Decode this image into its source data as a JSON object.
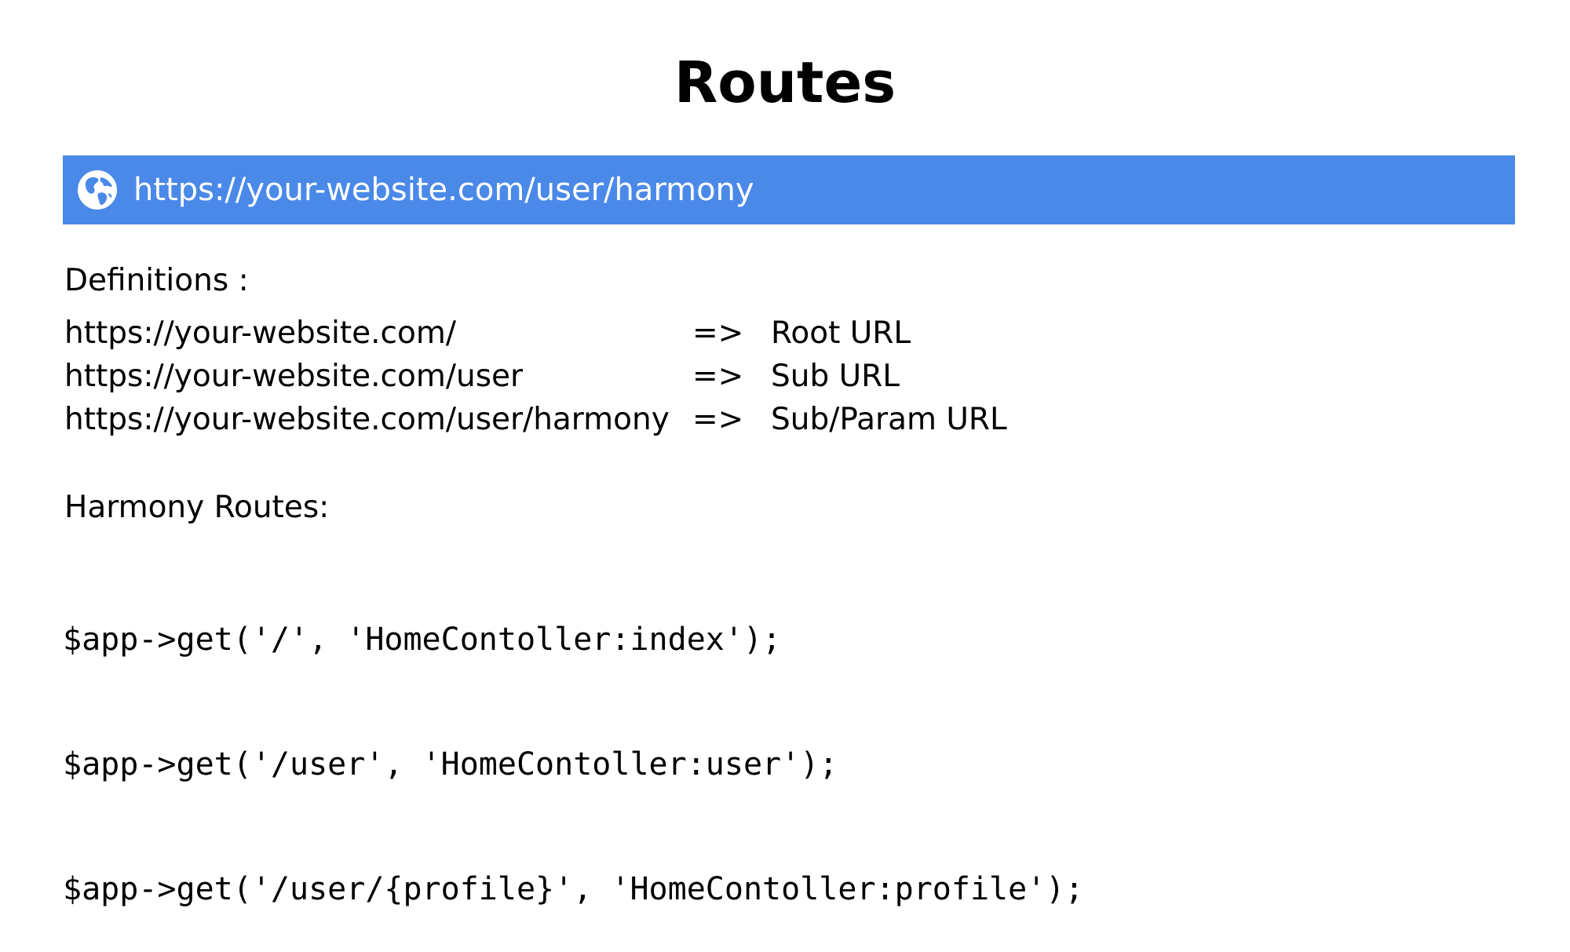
{
  "title": "Routes",
  "url_bar": {
    "icon": "globe-icon",
    "url": "https://your-website.com/user/harmony",
    "background_color": "#4a89e8"
  },
  "definitions": {
    "label": "Definitions :",
    "rows": [
      {
        "url": "https://your-website.com/",
        "arrow": "=>",
        "meaning": "Root URL"
      },
      {
        "url": "https://your-website.com/user",
        "arrow": "=>",
        "meaning": "Sub URL"
      },
      {
        "url": "https://your-website.com/user/harmony",
        "arrow": "=>",
        "meaning": "Sub/Param URL"
      }
    ]
  },
  "routes": {
    "label": "Harmony Routes:",
    "code_lines": [
      "$app->get('/', 'HomeContoller:index');",
      "$app->get('/user', 'HomeContoller:user');",
      "$app->get('/user/{profile}', 'HomeContoller:profile');"
    ]
  }
}
